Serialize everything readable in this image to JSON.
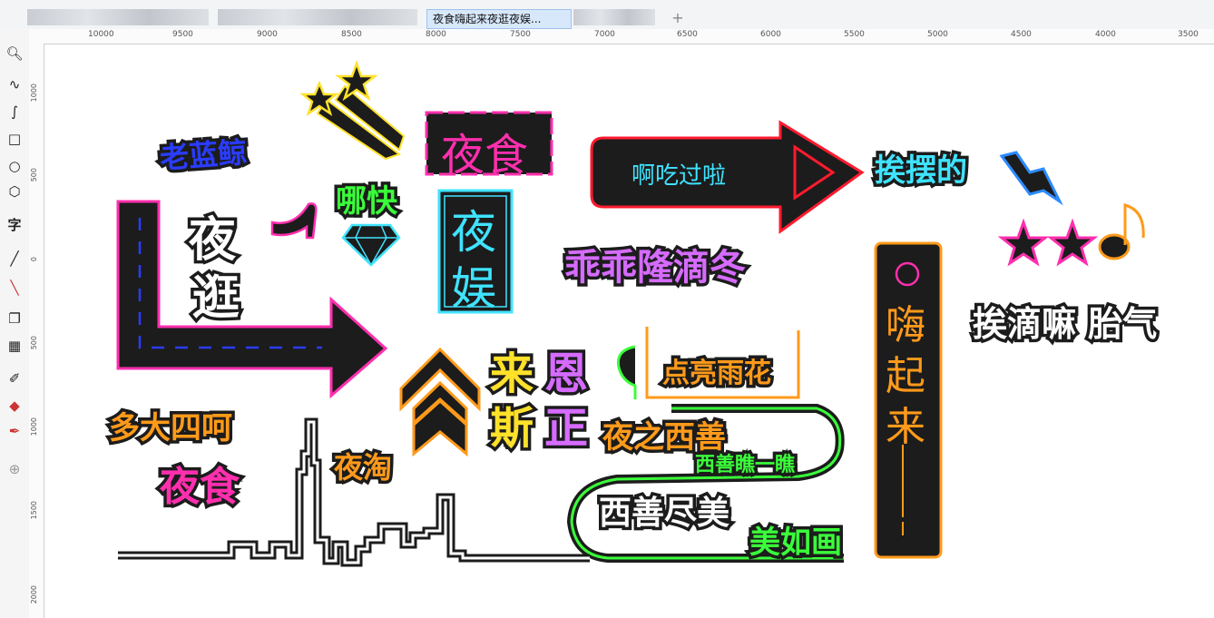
{
  "window": {
    "active_tab_title": "夜食嗨起来夜逛夜娱...",
    "new_tab_icon": "plus-icon"
  },
  "ruler": {
    "horizontal_labels": [
      "10000",
      "9500",
      "9000",
      "8500",
      "8000",
      "7500",
      "7000",
      "6500",
      "6000",
      "5500",
      "5000",
      "4500",
      "4000",
      "3500"
    ],
    "vertical_labels": [
      "1000",
      "500",
      "0",
      "500",
      "1000",
      "1500",
      "2000"
    ]
  },
  "toolbox": {
    "tools": [
      "zoom-icon",
      "freehand-icon",
      "curve-icon",
      "rectangle-icon",
      "ellipse-icon",
      "polygon-icon",
      "text-icon",
      "line-icon",
      "connector-icon",
      "shadow-icon",
      "transparency-icon",
      "eyedropper-icon",
      "fill-icon",
      "smart-fill-icon",
      "add-tool-icon"
    ]
  },
  "signs": {
    "lao_lan_jing": "老蓝鲸",
    "ye_shi_top": "夜食",
    "ye_yu": [
      "夜",
      "娱"
    ],
    "ye_guang": [
      "夜",
      "逛"
    ],
    "na_kuai": "哪快",
    "a_chi_guo_la": "啊吃过啦",
    "ai_bai_de": "挨摆的",
    "guai_guai": "乖乖隆滴冬",
    "hai_qi_lai": [
      "嗨",
      "起",
      "来"
    ],
    "ai_di_ma": "挨滴嘛 胎气",
    "lai_en_si_zheng": [
      "来",
      "恩",
      "斯",
      "正"
    ],
    "dian_liang": "点亮雨花",
    "ye_zhi_xi_shan": "夜之西善",
    "xi_shan_qiao": "西善瞧一瞧",
    "xi_shan_jin_mei": "西善尽美",
    "mei_ru_hua": "美如画",
    "duo_da_si_he": "多大四呵",
    "ye_shi_bottom": "夜食",
    "ye_tao": "夜淘"
  },
  "colors": {
    "pink": "#ff2fae",
    "blue": "#2a3cff",
    "cyan": "#3fe3ff",
    "green": "#3aff3a",
    "yellow": "#ffe12a",
    "orange": "#ff9a1a",
    "red": "#ff1a2e",
    "white": "#ffffff",
    "violet": "#d66bff",
    "dark": "#1c1c1c"
  }
}
